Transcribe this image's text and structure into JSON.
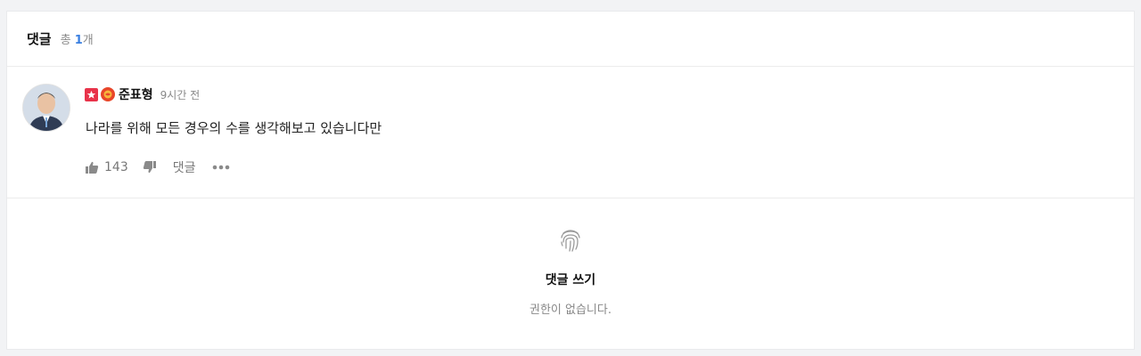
{
  "header": {
    "title": "댓글",
    "count_prefix": "총",
    "count": "1",
    "count_suffix": "개"
  },
  "comment": {
    "author": "준표형",
    "time": "9시간 전",
    "text": "나라를 위해 모든 경우의 수를 생각해보고 있습니다만",
    "likes": "143",
    "reply_label": "댓글",
    "avatar_icon": "avatar-photo",
    "badge_icons": [
      "star-badge-icon",
      "emblem-badge-icon"
    ]
  },
  "write": {
    "icon": "fingerprint-icon",
    "title": "댓글 쓰기",
    "message": "권한이 없습니다."
  },
  "colors": {
    "accent": "#3a7fe0",
    "badge_red": "#e8334a",
    "muted": "#888888"
  }
}
